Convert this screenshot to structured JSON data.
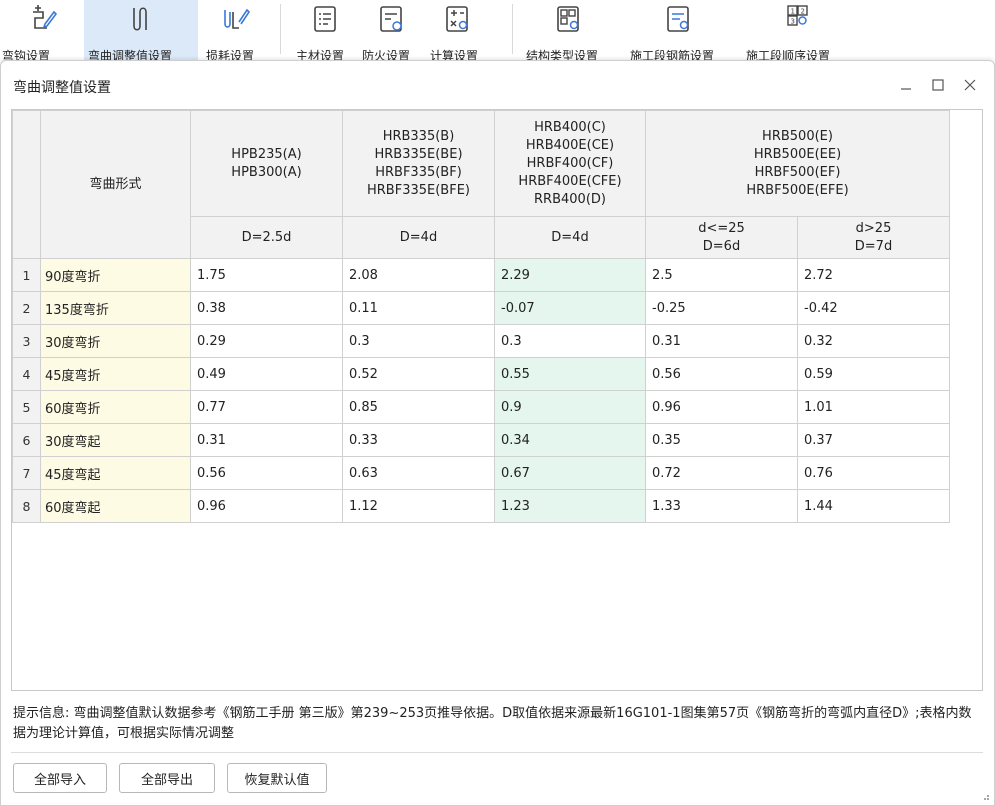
{
  "ribbon": {
    "items": [
      {
        "label": "弯钩设置",
        "icon": "hook-edit-icon"
      },
      {
        "label": "弯曲调整值设置",
        "icon": "bend-adjust-icon"
      },
      {
        "label": "损耗设置",
        "icon": "loss-icon"
      },
      {
        "label": "主材设置",
        "icon": "material-settings-icon"
      },
      {
        "label": "防火设置",
        "icon": "fire-settings-icon"
      },
      {
        "label": "计算设置",
        "icon": "calc-settings-icon"
      },
      {
        "label": "结构类型设置",
        "icon": "structure-type-icon"
      },
      {
        "label": "施工段钢筋设置",
        "icon": "segment-rebar-icon"
      },
      {
        "label": "施工段顺序设置",
        "icon": "segment-order-icon"
      }
    ]
  },
  "dialog": {
    "title": "弯曲调整值设置",
    "minimize_icon": "minimize-icon",
    "maximize_icon": "maximize-icon",
    "close_icon": "close-icon"
  },
  "table": {
    "header_form": "弯曲形式",
    "groups": [
      {
        "lines": [
          "HPB235(A)",
          "HPB300(A)"
        ],
        "sub": [
          [
            "D=2.5d"
          ]
        ]
      },
      {
        "lines": [
          "HRB335(B)",
          "HRB335E(BE)",
          "HRBF335(BF)",
          "HRBF335E(BFE)"
        ],
        "sub": [
          [
            "D=4d"
          ]
        ]
      },
      {
        "lines": [
          "HRB400(C)",
          "HRB400E(CE)",
          "HRBF400(CF)",
          "HRBF400E(CFE)",
          "RRB400(D)"
        ],
        "sub": [
          [
            "D=4d"
          ]
        ]
      },
      {
        "lines": [
          "HRB500(E)",
          "HRB500E(EE)",
          "HRBF500(EF)",
          "HRBF500E(EFE)"
        ],
        "sub": [
          [
            "d<=25",
            "D=6d"
          ],
          [
            "d>25",
            "D=7d"
          ]
        ]
      }
    ],
    "rows": [
      {
        "n": "1",
        "name": "90度弯折",
        "v": [
          "1.75",
          "2.08",
          "2.29",
          "2.5",
          "2.72"
        ],
        "hl": true
      },
      {
        "n": "2",
        "name": "135度弯折",
        "v": [
          "0.38",
          "0.11",
          "-0.07",
          "-0.25",
          "-0.42"
        ],
        "hl": true
      },
      {
        "n": "3",
        "name": "30度弯折",
        "v": [
          "0.29",
          "0.3",
          "0.3",
          "0.31",
          "0.32"
        ],
        "hl": false
      },
      {
        "n": "4",
        "name": "45度弯折",
        "v": [
          "0.49",
          "0.52",
          "0.55",
          "0.56",
          "0.59"
        ],
        "hl": true
      },
      {
        "n": "5",
        "name": "60度弯折",
        "v": [
          "0.77",
          "0.85",
          "0.9",
          "0.96",
          "1.01"
        ],
        "hl": true
      },
      {
        "n": "6",
        "name": "30度弯起",
        "v": [
          "0.31",
          "0.33",
          "0.34",
          "0.35",
          "0.37"
        ],
        "hl": true
      },
      {
        "n": "7",
        "name": "45度弯起",
        "v": [
          "0.56",
          "0.63",
          "0.67",
          "0.72",
          "0.76"
        ],
        "hl": true
      },
      {
        "n": "8",
        "name": "60度弯起",
        "v": [
          "0.96",
          "1.12",
          "1.23",
          "1.33",
          "1.44"
        ],
        "hl": true
      }
    ],
    "colors": {
      "name_bg": "#fdfbe4",
      "highlight_bg": "#e4f6ee",
      "header_bg": "#f2f2f2"
    }
  },
  "hint": "提示信息: 弯曲调整值默认数据参考《钢筋工手册 第三版》第239~253页推导依据。D取值依据来源最新16G101-1图集第57页《钢筋弯折的弯弧内直径D》;表格内数据为理论计算值，可根据实际情况调整",
  "buttons": {
    "import_all": "全部导入",
    "export_all": "全部导出",
    "restore_default": "恢复默认值"
  }
}
